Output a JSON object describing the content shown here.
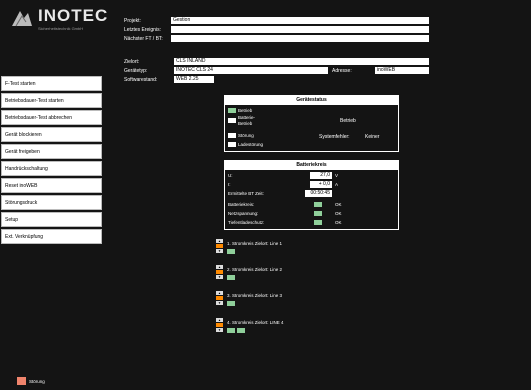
{
  "logo": {
    "text": "INOTEC",
    "subtitle": "Sicherheitstechnik GmbH"
  },
  "header": {
    "rows": [
      {
        "label": "Projekt:",
        "value": "Gestion"
      },
      {
        "label": "Letztes Ereignis:",
        "value": ""
      },
      {
        "label": "Nächster FT / BT:",
        "value": ""
      }
    ]
  },
  "menu": {
    "items": [
      "F-Test starten",
      "Betriebsdauer-Test starten",
      "Betriebsdauer-Test abbrechen",
      "Gerät blockieren",
      "Gerät freigeben",
      "Handrückschaltung",
      "Reset inoWEB",
      "Störungsdruck",
      "Setup",
      "Ext. Verknüpfung"
    ]
  },
  "device": {
    "zielort_label": "Zielort:",
    "zielort_value": "CLS INLAND",
    "geraetetyp_label": "Gerätetyp:",
    "geraetetyp_value": "INOTEC CLS 24",
    "adresse_label": "Adresse:",
    "adresse_value": "inoWEB",
    "software_label": "Softwarestand:",
    "software_value": "WEB 2.25"
  },
  "geraetestatus": {
    "title": "Gerätestatus",
    "items": [
      {
        "label": "Betrieb",
        "led": "green"
      },
      {
        "label": "Batterie-Betrieb",
        "led": "white"
      },
      {
        "label": "Störung",
        "led": "white"
      },
      {
        "label": "Ladestörung",
        "led": "white"
      }
    ],
    "status_value": "Betrieb",
    "systemfehler_label": "Systemfehler:",
    "systemfehler_value": "Keiner"
  },
  "batteriekreis": {
    "title": "Batteriekreis",
    "values": [
      {
        "label": "U:",
        "value": "27,0",
        "unit": "V"
      },
      {
        "label": "I:",
        "value": "+ 0,0",
        "unit": "A"
      },
      {
        "label": "Ermittelte BT Zeit:",
        "value": "00:50:45",
        "unit": ""
      }
    ],
    "states": [
      {
        "label": "Batteriekreis:",
        "value": "OK"
      },
      {
        "label": "Netzspannung:",
        "value": "OK"
      },
      {
        "label": "Tiefentladeschutz:",
        "value": "OK"
      }
    ]
  },
  "circuits": [
    {
      "label": "1. Stromkreis Zielort: Line 1",
      "leds": 1
    },
    {
      "label": "2. Stromkreis Zielort: Line 2",
      "leds": 1
    },
    {
      "label": "3. Stromkreis Zielort: Line 3",
      "leds": 1
    },
    {
      "label": "4. Stromkreis Zielort: LINE 4",
      "leds": 2
    }
  ],
  "footer": {
    "status_label": "Störung"
  },
  "colors": {
    "led_green": "#8fcf9a",
    "accent_orange": "#ff8a00",
    "status_red": "#f0846c"
  }
}
